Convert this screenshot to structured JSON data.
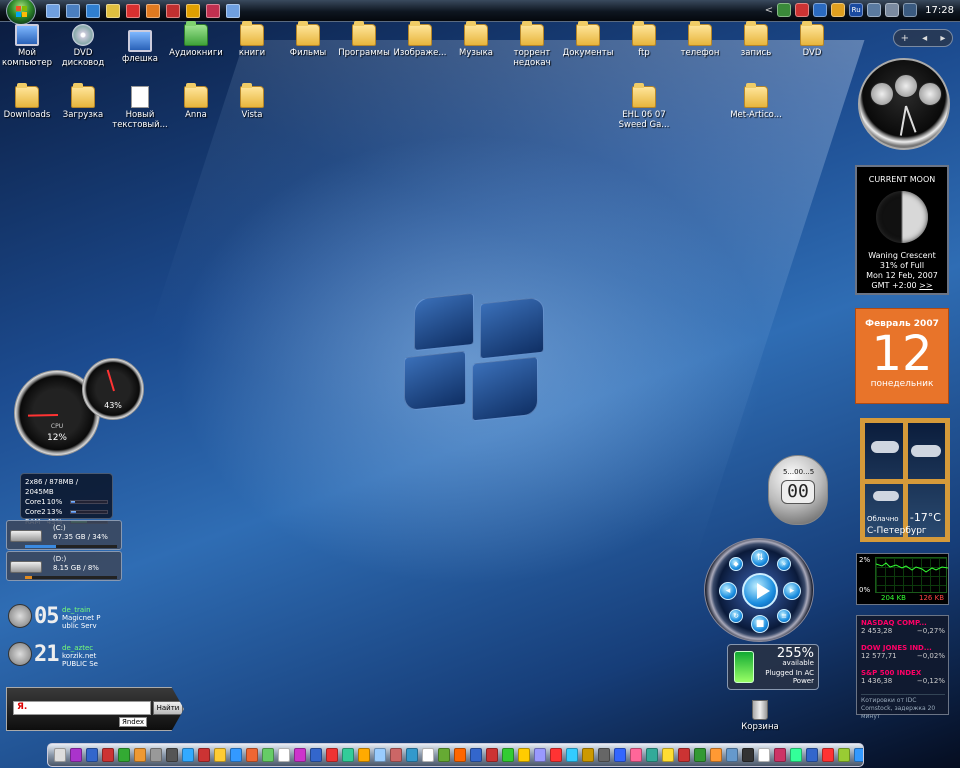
{
  "taskbar": {
    "clock": "17:28",
    "tray_arrow": "<",
    "lang": "Ru",
    "quicklaunch_icons": [
      "show-desktop-icon",
      "switch-windows-icon",
      "ie-icon",
      "media-player-icon",
      "opera-icon",
      "firefox-icon",
      "total-commander-icon",
      "flashget-icon",
      "winrar-icon",
      "messenger-icon"
    ],
    "quicklaunch_colors": [
      "#6fa0e0",
      "#4a7fc0",
      "#2f7fd0",
      "#e0c040",
      "#d83030",
      "#e07a20",
      "#c03030",
      "#e0a000",
      "#c03050",
      "#6fa0e0"
    ]
  },
  "desktop": {
    "icons": [
      {
        "label": "Мой компьютер",
        "kind": "monitor"
      },
      {
        "label": "DVD дисковод",
        "kind": "disc"
      },
      {
        "label": "флешка",
        "kind": "monitor"
      },
      {
        "label": "Аудиокниги",
        "kind": "folder-green"
      },
      {
        "label": "книги",
        "kind": "folder"
      },
      {
        "label": "Фильмы",
        "kind": "folder"
      },
      {
        "label": "Программы",
        "kind": "folder"
      },
      {
        "label": "Изображе...",
        "kind": "folder"
      },
      {
        "label": "Музыка",
        "kind": "folder"
      },
      {
        "label": "торрент недокач",
        "kind": "folder"
      },
      {
        "label": "Документы",
        "kind": "folder"
      },
      {
        "label": "ftp",
        "kind": "folder"
      },
      {
        "label": "телефон",
        "kind": "folder"
      },
      {
        "label": "запись",
        "kind": "folder"
      },
      {
        "label": "DVD",
        "kind": "folder"
      },
      {
        "label": "Downloads",
        "kind": "folder"
      },
      {
        "label": "Загрузка",
        "kind": "folder"
      },
      {
        "label": "Новый текстовый...",
        "kind": "file"
      },
      {
        "label": "Anna",
        "kind": "folder"
      },
      {
        "label": "Vista",
        "kind": "folder"
      },
      {
        "label": "EHL 06 07 Sweed Ga...",
        "kind": "folder"
      },
      {
        "label": "Met-Artico...",
        "kind": "folder"
      }
    ]
  },
  "gadget_handle": {
    "add": "+",
    "prev": "◂",
    "next": "▸"
  },
  "moon": {
    "title": "CURRENT MOON",
    "phase": "Waning Crescent",
    "full": "31% of Full",
    "date": "Mon 12 Feb, 2007",
    "gmt": "GMT +2:00",
    "more": ">>"
  },
  "calendar": {
    "month": "Февраль 2007",
    "day": "12",
    "weekday": "понедельник"
  },
  "weather": {
    "condition": "Облачно",
    "temp": "-17°C",
    "city": "С-Петербург"
  },
  "network": {
    "top_label": "2%",
    "bottom_label": "0%",
    "download": "204 KB",
    "upload": "126 KB"
  },
  "stocks": {
    "rows": [
      {
        "name": "NASDAQ COMP...",
        "price": "2 453,28",
        "change": "−0,27%"
      },
      {
        "name": "DOW JONES IND...",
        "price": "12 577,71",
        "change": "−0,02%"
      },
      {
        "name": "S&P 500 INDEX",
        "price": "1 436,38",
        "change": "−0,12%"
      }
    ],
    "footer": "Котировки от IDC Comstock, задержка 20 минут"
  },
  "cpu_meter": {
    "cpu_label": "CPU",
    "cpu_pct": "12%",
    "cpu_value": 0.12,
    "mem_pct": "43%",
    "mem_value": 0.43
  },
  "sysinfo": {
    "header": "2x86 / 878MB / 2045MB",
    "rows": [
      {
        "name": "Core1",
        "pct": "10%",
        "value": 0.1
      },
      {
        "name": "Core2",
        "pct": "13%",
        "value": 0.13
      },
      {
        "name": "RAM",
        "pct": "43%",
        "value": 0.43
      }
    ]
  },
  "drives": [
    {
      "letter": "(C:)",
      "info": "67.35 GB / 34%",
      "value": 0.34,
      "color": "#3a8ae0"
    },
    {
      "letter": "(D:)",
      "info": "8.15 GB / 8%",
      "value": 0.08,
      "color": "#e08a20"
    }
  ],
  "servers": [
    {
      "num": "05",
      "name": "de_train",
      "line1": "Magicnet P",
      "line2": "ublic Serv"
    },
    {
      "num": "21",
      "name": "de_aztec",
      "line1": "korzik.net",
      "line2": "PUBLIC Se"
    }
  ],
  "yandex": {
    "input_value": "Я.",
    "button": "Найти",
    "logo": "Яndex"
  },
  "timer": {
    "value": "00",
    "ticks": "5...00...5"
  },
  "battery": {
    "pct": "255%",
    "available": "available",
    "status": "Plugged In AC Power"
  },
  "trash": {
    "label": "Корзина"
  },
  "dock": {
    "colors": [
      "#ddd",
      "#a3c",
      "#36c",
      "#c33",
      "#3a3",
      "#e93",
      "#999",
      "#555",
      "#3af",
      "#c33",
      "#fc3",
      "#39f",
      "#e63",
      "#6c6",
      "#fff",
      "#c3c",
      "#36c",
      "#e33",
      "#3c9",
      "#fa0",
      "#9cf",
      "#c66",
      "#39c",
      "#fff",
      "#6a3",
      "#f60",
      "#36c",
      "#c33",
      "#3c3",
      "#fc0",
      "#99f",
      "#f33",
      "#3cf",
      "#c90",
      "#666",
      "#36f",
      "#f69",
      "#3a9",
      "#fd3",
      "#c33",
      "#393",
      "#f93",
      "#69c",
      "#333",
      "#fff",
      "#c36",
      "#3f9",
      "#36c",
      "#f33",
      "#9c3",
      "#39f",
      "#f90",
      "#c3c",
      "#6cf",
      "#333",
      "#f66",
      "#3c6",
      "#fc3"
    ]
  }
}
